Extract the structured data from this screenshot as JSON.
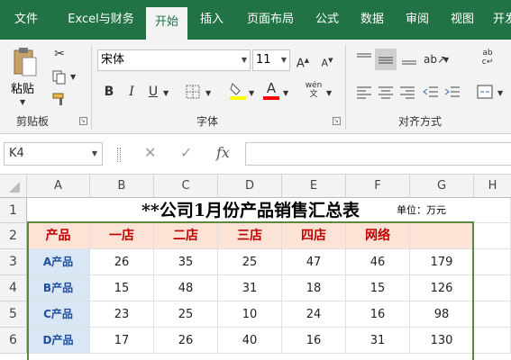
{
  "ribbon_tabs": [
    "文件",
    "Excel与财务",
    "开始",
    "插入",
    "页面布局",
    "公式",
    "数据",
    "审阅",
    "视图",
    "开发"
  ],
  "active_tab": "开始",
  "clipboard": {
    "paste_label": "粘贴",
    "group_label": "剪贴板"
  },
  "font": {
    "name": "宋体",
    "size": "11",
    "group_label": "字体",
    "bold": "B",
    "italic": "I",
    "underline": "U",
    "wen": "wén"
  },
  "alignment": {
    "group_label": "对齐方式"
  },
  "formula_bar": {
    "name_box": "K4",
    "cancel": "✕",
    "enter": "✓",
    "fx": "fx",
    "value": ""
  },
  "columns": [
    "A",
    "B",
    "C",
    "D",
    "E",
    "F",
    "G",
    "H"
  ],
  "rows": [
    "1",
    "2",
    "3",
    "4",
    "5",
    "6"
  ],
  "sheet": {
    "title": "**公司1月份产品销售汇总表",
    "unit": "单位：万元",
    "headers": [
      "产品",
      "一店",
      "二店",
      "三店",
      "四店",
      "网络",
      ""
    ],
    "data": [
      [
        "A产品",
        "26",
        "35",
        "25",
        "47",
        "46",
        "179"
      ],
      [
        "B产品",
        "15",
        "48",
        "31",
        "18",
        "15",
        "126"
      ],
      [
        "C产品",
        "23",
        "25",
        "10",
        "24",
        "16",
        "98"
      ],
      [
        "D产品",
        "17",
        "26",
        "40",
        "16",
        "31",
        "130"
      ]
    ]
  },
  "colors": {
    "excel_green": "#217346",
    "header_fill": "#fde3d6",
    "header_text": "#c00000",
    "product_fill": "#d9e6f4",
    "table_border": "#5b8a3a"
  }
}
